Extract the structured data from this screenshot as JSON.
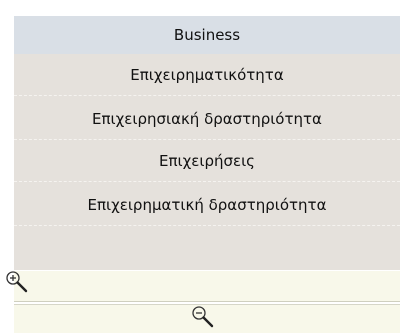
{
  "header": {
    "title": "Business"
  },
  "items": [
    {
      "label": "Επιχειρηματικότητα"
    },
    {
      "label": "Επιχειρησιακή δραστηριότητα"
    },
    {
      "label": "Επιχειρήσεις"
    },
    {
      "label": "Επιχειρηματική δραστηριότητα"
    }
  ],
  "icons": {
    "zoom_in": "zoom-in-magnifier",
    "zoom_out": "zoom-out-magnifier"
  },
  "colors": {
    "header_bg": "#d9dfe6",
    "rows_bg": "#e5e1dc",
    "zoom_bar_bg": "#f8f8ea"
  }
}
